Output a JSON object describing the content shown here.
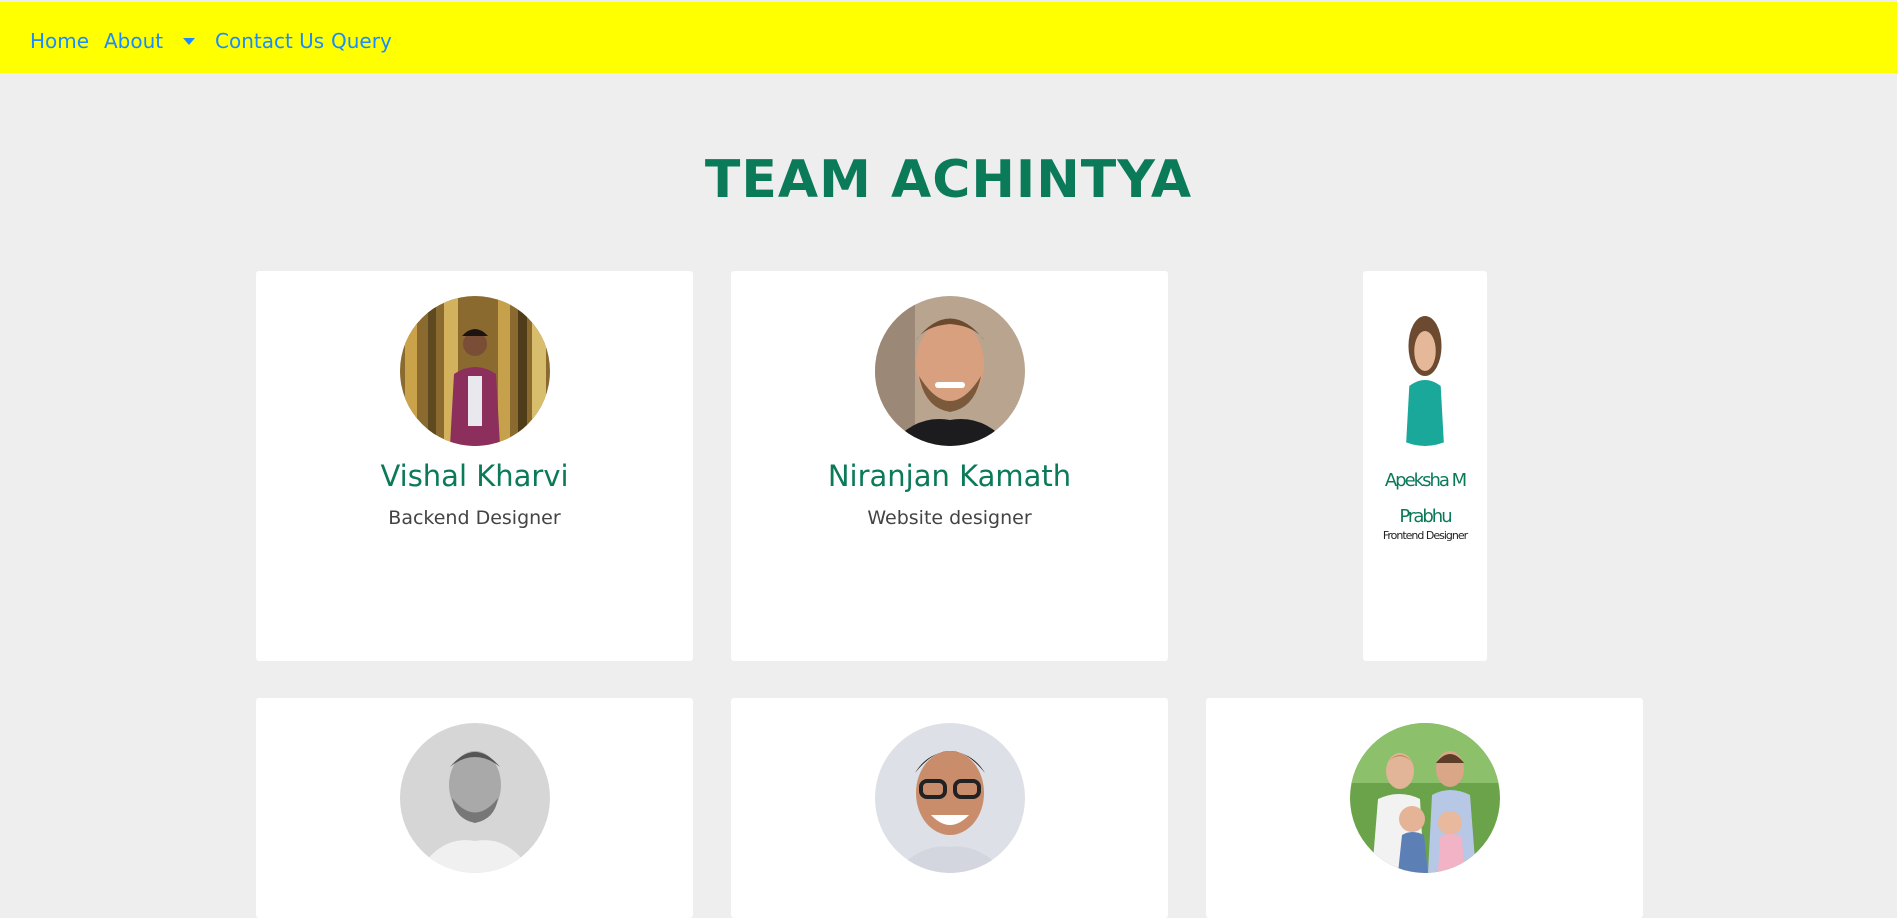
{
  "nav": {
    "home": "Home",
    "about": "About",
    "contact": "Contact Us",
    "query": "Query"
  },
  "title": "TEAM ACHINTYA",
  "members": [
    {
      "name": "Vishal Kharvi",
      "role": "Backend Designer",
      "photo": "photo-man-bamboo"
    },
    {
      "name": "Niranjan Kamath",
      "role": "Website designer",
      "photo": "photo-man-beard"
    },
    {
      "name": "Apeksha M Prabhu",
      "role": "Frontend Designer",
      "photo": "photo-woman-teal"
    },
    {
      "name": "",
      "role": "",
      "photo": "photo-man-grayscale"
    },
    {
      "name": "",
      "role": "",
      "photo": "photo-man-glasses"
    },
    {
      "name": "",
      "role": "",
      "photo": "photo-family"
    }
  ],
  "colors": {
    "navbar": "#ffff00",
    "link": "#1a8cff",
    "accent_green": "#0b7a59",
    "background": "#eeeeee",
    "card": "#ffffff"
  }
}
